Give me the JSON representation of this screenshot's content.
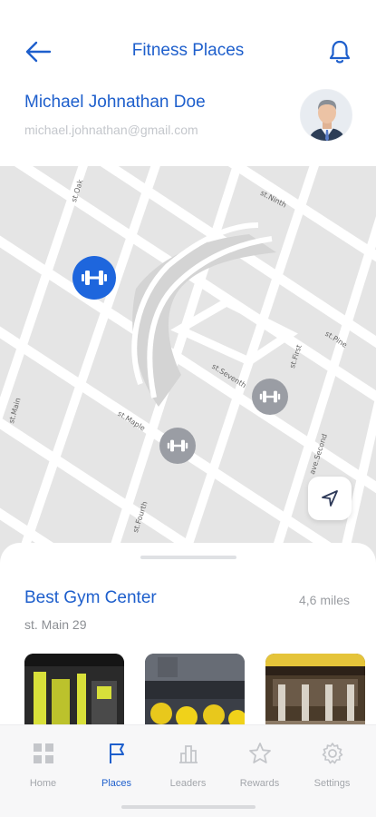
{
  "header": {
    "title": "Fitness Places",
    "back_icon": "arrow-left-icon",
    "notification_icon": "bell-icon"
  },
  "profile": {
    "name": "Michael Johnathan Doe",
    "email": "michael.johnathan@gmail.com",
    "avatar_icon": "avatar-photo"
  },
  "map": {
    "streets": [
      "st.Oak",
      "st.Ninth",
      "st.Pine",
      "st.Seventh",
      "st.First",
      "st.Main",
      "st.Maple",
      "ave.Second",
      "st.Fourth"
    ],
    "markers": [
      {
        "name": "gym-marker-selected",
        "state": "active"
      },
      {
        "name": "gym-marker",
        "state": "inactive"
      },
      {
        "name": "gym-marker",
        "state": "inactive"
      }
    ],
    "locate_icon": "navigation-arrow-icon"
  },
  "place": {
    "name": "Best Gym Center",
    "distance": "4,6 miles",
    "address": "st. Main 29",
    "photos": [
      "gym-photo-1",
      "gym-photo-2",
      "gym-photo-3"
    ]
  },
  "tabs": [
    {
      "label": "Home",
      "icon": "grid-icon",
      "active": false
    },
    {
      "label": "Places",
      "icon": "flag-icon",
      "active": true
    },
    {
      "label": "Leaders",
      "icon": "bar-chart-icon",
      "active": false
    },
    {
      "label": "Rewards",
      "icon": "star-icon",
      "active": false
    },
    {
      "label": "Settings",
      "icon": "gear-icon",
      "active": false
    }
  ],
  "colors": {
    "accent": "#1e5fcc",
    "marker_active": "#1e66dd",
    "marker_inactive": "#9a9da4",
    "map_bg": "#e5e5e5",
    "tab_inactive": "#a3a6ab"
  }
}
